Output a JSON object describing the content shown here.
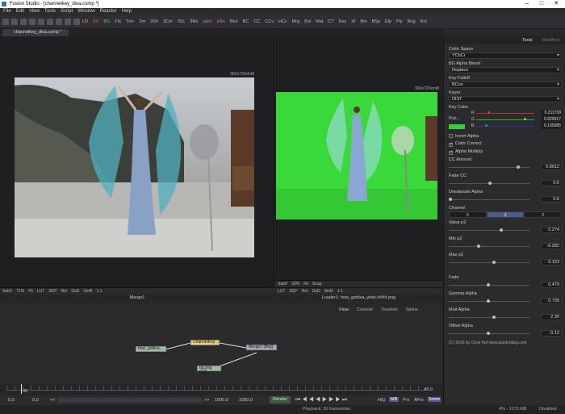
{
  "title_bar": {
    "title": "Fusion Studio - [channelkey_diva.comp *]"
  },
  "menu": [
    "File",
    "Edit",
    "View",
    "Tools",
    "Script",
    "Window",
    "Reactor",
    "Help"
  ],
  "toolbar": [
    "LD",
    "SV",
    "BG",
    "FN",
    "Txt+",
    "3m",
    "3Sh",
    "3Cm",
    "3SL",
    "3Rn",
    "pEm",
    "pRn",
    "Blur",
    "BC",
    "CC",
    "CCv",
    "HCv",
    "Mrg",
    "Bol",
    "Mat",
    "CT",
    "Rsz",
    "Xf",
    "Bm",
    "BSp",
    "Elp",
    "Ply",
    "Rng",
    "Rct"
  ],
  "doc_tab": "channelkey_diva.comp *",
  "viewer_left": {
    "resolution": "960x720xint8",
    "bar": [
      "SubV",
      "71%",
      "Fit",
      "LUT",
      "360°",
      "RoI",
      "DoD",
      "SmR",
      "1:1"
    ],
    "label": "Merge1"
  },
  "viewer_right": {
    "resolution": "960x720xint8",
    "bar": [
      "SubV",
      "50%",
      "Fit",
      "Snap",
      "LUT",
      "360°",
      "RoI",
      "DoD",
      "SmR",
      "1:1"
    ],
    "label": "Loader1: how_godiva_wide.####.png"
  },
  "node_header": [
    "Flow",
    "Console",
    "Timeline",
    "Spline"
  ],
  "nodes": {
    "loader": "how_godiva...",
    "key": "ChannelKey...",
    "merge": "Merge1 (Bkg)",
    "bg": "bg.png (LD)"
  },
  "timeline": {
    "start_marker": "45",
    "end": "45.0"
  },
  "transport": {
    "cur": "0.0",
    "start": "0.0",
    "render_start": "1000.0",
    "render_end": "1000.0",
    "render_btn": "Render",
    "hiq": "HiQ",
    "mb": "MB",
    "prx": "Prx",
    "aprx": "APrx",
    "some": "Some"
  },
  "status": {
    "playback": "Playback: 30 frames/sec",
    "mem": "4% - 1173 MB",
    "state": "Disabled"
  },
  "panel": {
    "tabs": [
      "Tools",
      "Modifiers"
    ],
    "color_space": {
      "label": "Color Space",
      "value": "YCbCr"
    },
    "bg_alpha_blend": {
      "label": "BG Alpha Blend",
      "value": "Replace"
    },
    "key_falloff": {
      "label": "Key Falloff",
      "value": "BCos"
    },
    "keyer": {
      "label": "Keyer",
      "value": "DIST"
    },
    "key_color": {
      "label": "Key Color",
      "pick": "Pick...",
      "r_label": "R",
      "g_label": "G",
      "b_label": "B",
      "r": "0.211709",
      "g": "0.829517",
      "b": "0.165085",
      "swatch": "#2ed13a"
    },
    "invert_alpha": "Invert Alpha",
    "color_correct": "Color Correct",
    "alpha_multiply": "Alpha Multiply",
    "cc_amount": {
      "label": "CC Amount",
      "value": "0.8612",
      "pos": 0.86
    },
    "fade_cc": {
      "label": "Fade CC",
      "value": "0.5",
      "pos": 0.5
    },
    "desat_alpha": {
      "label": "Desaturate Alpha",
      "value": "0.0",
      "pos": 0.0
    },
    "channel": {
      "label": "Channel",
      "options": [
        "0",
        "1",
        "2"
      ],
      "selected": 1
    },
    "value_p2": {
      "label": "Value p2",
      "value": "0.274",
      "pos": 0.64
    },
    "min_p2": {
      "label": "Min p2",
      "value": "-0.282",
      "pos": 0.36
    },
    "max_p2": {
      "label": "Max p2",
      "value": "0.103",
      "pos": 0.55
    },
    "fade": {
      "label": "Fade",
      "value": "0.479",
      "pos": 0.48
    },
    "gamma_alpha": {
      "label": "Gamma Alpha",
      "value": "0.735",
      "pos": 0.48
    },
    "mult_alpha": {
      "label": "Mult Alpha",
      "value": "2.39",
      "pos": 0.55
    },
    "offset_alpha": {
      "label": "Offset Alpha",
      "value": "-0.12",
      "pos": 0.48
    },
    "credit": "(C) 2019 by Chris Huf www.splotchdog.com"
  }
}
